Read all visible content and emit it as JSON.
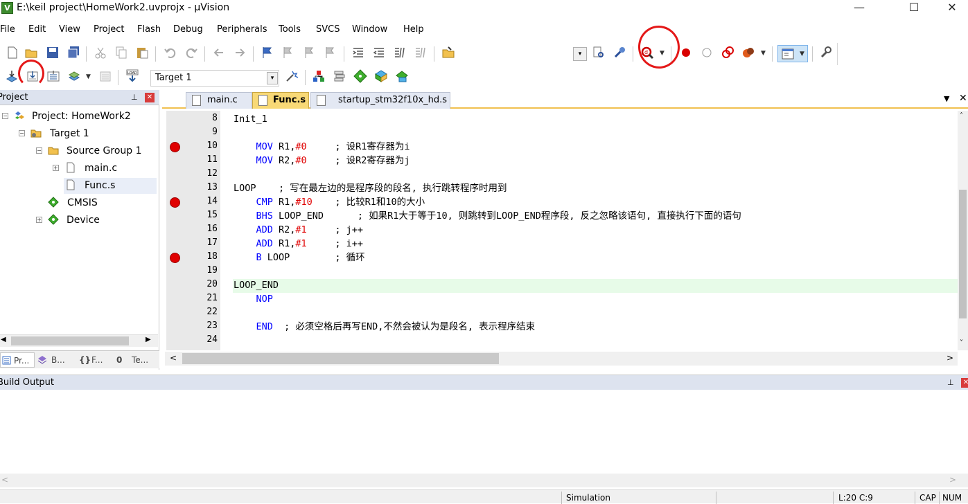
{
  "window": {
    "title": "E:\\keil project\\HomeWork2.uvprojx - µVision",
    "app_icon_letter": "V",
    "minimize": "—",
    "maximize": "☐",
    "close": "✕"
  },
  "menu": [
    "File",
    "Edit",
    "View",
    "Project",
    "Flash",
    "Debug",
    "Peripherals",
    "Tools",
    "SVCS",
    "Window",
    "Help"
  ],
  "toolbar2": {
    "target": "Target 1"
  },
  "project_panel": {
    "title": "Project",
    "pin": "⊥",
    "tree": [
      {
        "label": "Project: HomeWork2"
      },
      {
        "label": "Target 1"
      },
      {
        "label": "Source Group 1"
      },
      {
        "label": "main.c"
      },
      {
        "label": "Func.s"
      },
      {
        "label": "CMSIS"
      },
      {
        "label": "Device"
      }
    ],
    "tabs": [
      "Pr...",
      "B...",
      "F...",
      "Te..."
    ],
    "tab_icons": [
      "{}",
      "0"
    ]
  },
  "editor": {
    "tabs": [
      {
        "label": "main.c",
        "active": false
      },
      {
        "label": "Func.s",
        "active": true
      },
      {
        "label": "startup_stm32f10x_hd.s",
        "active": false
      }
    ],
    "tab_menu": "▼",
    "tab_close": "✕",
    "lines": [
      {
        "n": "8",
        "html": "Init_1"
      },
      {
        "n": "9",
        "html": ""
      },
      {
        "n": "10",
        "html": "    <span class=\"kw\">MOV</span> R1,<span class=\"num\">#0</span>     ; 设R1寄存器为i"
      },
      {
        "n": "11",
        "html": "    <span class=\"kw\">MOV</span> R2,<span class=\"num\">#0</span>     ; 设R2寄存器为j"
      },
      {
        "n": "12",
        "html": ""
      },
      {
        "n": "13",
        "html": "LOOP    ; 写在最左边的是程序段的段名, 执行跳转程序时用到"
      },
      {
        "n": "14",
        "html": "    <span class=\"kw\">CMP</span> R1,<span class=\"num\">#10</span>    ; 比较R1和10的大小"
      },
      {
        "n": "15",
        "html": "    <span class=\"kw\">BHS</span> LOOP_END      ; 如果R1大于等于10, 则跳转到LOOP_END程序段, 反之忽略该语句, 直接执行下面的语句"
      },
      {
        "n": "16",
        "html": "    <span class=\"kw\">ADD</span> R2,<span class=\"num\">#1</span>     ; j++"
      },
      {
        "n": "17",
        "html": "    <span class=\"kw\">ADD</span> R1,<span class=\"num\">#1</span>     ; i++"
      },
      {
        "n": "18",
        "html": "    <span class=\"kw\">B</span> LOOP        ; 循环"
      },
      {
        "n": "19",
        "html": ""
      },
      {
        "n": "20",
        "html": "LOOP_END"
      },
      {
        "n": "21",
        "html": "    <span class=\"kw\">NOP</span>"
      },
      {
        "n": "22",
        "html": ""
      },
      {
        "n": "23",
        "html": "    <span class=\"kw\">END</span>  ; 必须空格后再写END,不然会被认为是段名, 表示程序结束"
      },
      {
        "n": "24",
        "html": ""
      }
    ],
    "breakpoint_lines": [
      "10",
      "14",
      "18"
    ],
    "current_line": "20"
  },
  "build_output": {
    "title": "Build Output"
  },
  "status": {
    "mode": "Simulation",
    "position": "L:20 C:9",
    "caps": "CAP",
    "num": "NUM"
  },
  "colors": {
    "keyword": "#0000ff",
    "number": "#e00000",
    "annotation": "#e41818",
    "current_line_bg": "#e7fbe8"
  }
}
